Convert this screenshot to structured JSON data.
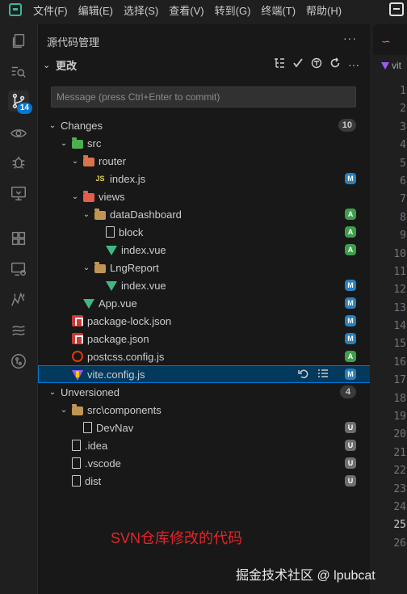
{
  "menu": [
    "文件(F)",
    "编辑(E)",
    "选择(S)",
    "查看(V)",
    "转到(G)",
    "终端(T)",
    "帮助(H)"
  ],
  "activity_bar": {
    "items": [
      "explorer-icon",
      "search-icon",
      "source-control-icon",
      "run-debug-icon",
      "debug-icon",
      "remote-explorer-icon",
      "extensions-icon",
      "remote-icon",
      "timeline-icon",
      "prettier-icon",
      "gitlens-icon"
    ],
    "source_control_badge": "14"
  },
  "sidebar": {
    "title": "源代码管理",
    "more": "···",
    "section": {
      "title": "更改"
    },
    "message_placeholder": "Message (press Ctrl+Enter to commit)"
  },
  "changes": {
    "label": "Changes",
    "count": "10",
    "items": [
      {
        "label": "src",
        "depth": 1,
        "icon": "folder-src",
        "chevron": "open"
      },
      {
        "label": "router",
        "depth": 2,
        "icon": "folder-router",
        "chevron": "open"
      },
      {
        "label": "index.js",
        "depth": 3,
        "icon": "js",
        "status": "M"
      },
      {
        "label": "views",
        "depth": 2,
        "icon": "folder-views",
        "chevron": "open"
      },
      {
        "label": "dataDashboard",
        "depth": 3,
        "icon": "folder",
        "chevron": "open",
        "status": "A"
      },
      {
        "label": "block",
        "depth": 4,
        "icon": "file",
        "status": "A"
      },
      {
        "label": "index.vue",
        "depth": 4,
        "icon": "vue",
        "status": "A"
      },
      {
        "label": "LngReport",
        "depth": 3,
        "icon": "folder",
        "chevron": "open"
      },
      {
        "label": "index.vue",
        "depth": 4,
        "icon": "vue",
        "status": "M"
      },
      {
        "label": "App.vue",
        "depth": 2,
        "icon": "vue",
        "status": "M"
      },
      {
        "label": "package-lock.json",
        "depth": 1,
        "icon": "npm",
        "status": "M"
      },
      {
        "label": "package.json",
        "depth": 1,
        "icon": "npm",
        "status": "M"
      },
      {
        "label": "postcss.config.js",
        "depth": 1,
        "icon": "postcss",
        "status": "A"
      },
      {
        "label": "vite.config.js",
        "depth": 1,
        "icon": "vite",
        "status": "M",
        "selected": true
      }
    ]
  },
  "unversioned": {
    "label": "Unversioned",
    "count": "4",
    "items": [
      {
        "label": "src\\components",
        "depth": 1,
        "icon": "folder",
        "chevron": "open"
      },
      {
        "label": "DevNav",
        "depth": 2,
        "icon": "file",
        "status": "U"
      },
      {
        "label": ".idea",
        "depth": 1,
        "icon": "file",
        "status": "U"
      },
      {
        "label": ".vscode",
        "depth": 1,
        "icon": "file",
        "status": "U"
      },
      {
        "label": "dist",
        "depth": 1,
        "icon": "file",
        "status": "U"
      }
    ]
  },
  "editor": {
    "breadcrumb": "vit",
    "line_numbers": [
      "1",
      "2",
      "3",
      "4",
      "5",
      "6",
      "7",
      "8",
      "9",
      "10",
      "11",
      "12",
      "13",
      "14",
      "15",
      "16",
      "17",
      "18",
      "19",
      "20",
      "21",
      "22",
      "23",
      "24",
      "25",
      "26"
    ],
    "current_line": "25"
  },
  "annotation": "SVN仓库修改的代码",
  "watermark": "掘金技术社区 @ lpubcat"
}
